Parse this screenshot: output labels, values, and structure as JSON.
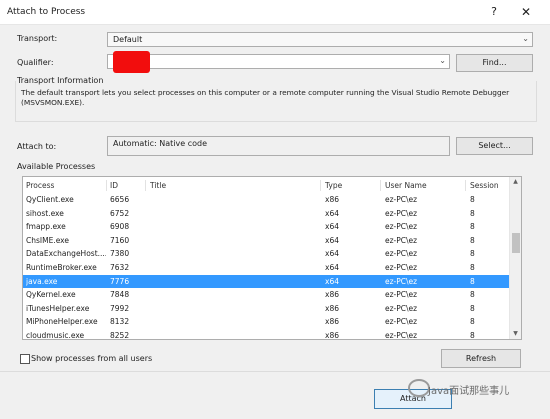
{
  "window": {
    "title": "Attach to Process",
    "help_label": "?",
    "close_label": "✕"
  },
  "transport": {
    "label": "Transport:",
    "value": "Default"
  },
  "qualifier": {
    "label": "Qualifier:",
    "find_button": "Find..."
  },
  "transport_info": {
    "heading": "Transport Information",
    "text": "The default transport lets you select processes on this computer or a remote computer running the Visual Studio Remote Debugger (MSVSMON.EXE)."
  },
  "attach_to": {
    "label": "Attach to:",
    "value": "Automatic: Native code",
    "select_button": "Select..."
  },
  "processes": {
    "heading": "Available Processes",
    "columns": {
      "process": "Process",
      "id": "ID",
      "title": "Title",
      "type": "Type",
      "user": "User Name",
      "session": "Session"
    },
    "rows": [
      {
        "process": "QyClient.exe",
        "id": "6656",
        "title": "",
        "type": "x86",
        "user": "ez-PC\\ez",
        "session": "8"
      },
      {
        "process": "sihost.exe",
        "id": "6752",
        "title": "",
        "type": "x64",
        "user": "ez-PC\\ez",
        "session": "8"
      },
      {
        "process": "fmapp.exe",
        "id": "6908",
        "title": "",
        "type": "x64",
        "user": "ez-PC\\ez",
        "session": "8"
      },
      {
        "process": "ChsIME.exe",
        "id": "7160",
        "title": "",
        "type": "x64",
        "user": "ez-PC\\ez",
        "session": "8"
      },
      {
        "process": "DataExchangeHost....",
        "id": "7380",
        "title": "",
        "type": "x64",
        "user": "ez-PC\\ez",
        "session": "8"
      },
      {
        "process": "RuntimeBroker.exe",
        "id": "7632",
        "title": "",
        "type": "x64",
        "user": "ez-PC\\ez",
        "session": "8"
      },
      {
        "process": "java.exe",
        "id": "7776",
        "title": "",
        "type": "x64",
        "user": "ez-PC\\ez",
        "session": "8",
        "selected": true
      },
      {
        "process": "QyKernel.exe",
        "id": "7848",
        "title": "",
        "type": "x86",
        "user": "ez-PC\\ez",
        "session": "8"
      },
      {
        "process": "iTunesHelper.exe",
        "id": "7992",
        "title": "",
        "type": "x86",
        "user": "ez-PC\\ez",
        "session": "8"
      },
      {
        "process": "MiPhoneHelper.exe",
        "id": "8132",
        "title": "",
        "type": "x86",
        "user": "ez-PC\\ez",
        "session": "8"
      },
      {
        "process": "cloudmusic.exe",
        "id": "8252",
        "title": "",
        "type": "x86",
        "user": "ez-PC\\ez",
        "session": "8"
      }
    ],
    "show_all_label": "Show processes from all users",
    "refresh_button": "Refresh"
  },
  "footer": {
    "attach_button": "Attach",
    "watermark": "Java面试那些事儿"
  },
  "colors": {
    "selection": "#3399ff",
    "redaction": "#f20d0d"
  }
}
